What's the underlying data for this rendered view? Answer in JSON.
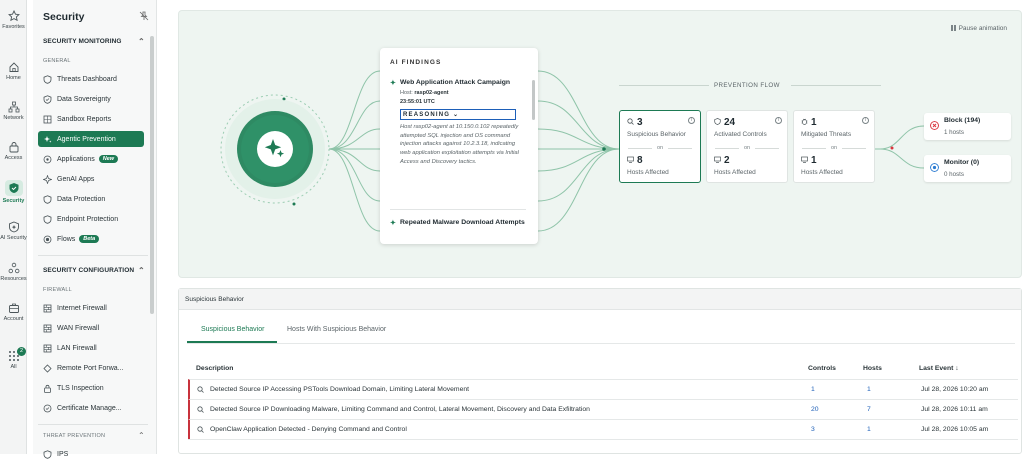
{
  "rail": [
    {
      "label": "Favorites",
      "icon": "star-icon"
    },
    {
      "label": "Home",
      "icon": "home-icon"
    },
    {
      "label": "Network",
      "icon": "network-icon"
    },
    {
      "label": "Access",
      "icon": "lock-icon"
    },
    {
      "label": "Security",
      "icon": "shield-icon"
    },
    {
      "label": "AI Security",
      "icon": "ai-shield-icon"
    },
    {
      "label": "Resources",
      "icon": "resources-icon"
    },
    {
      "label": "Account",
      "icon": "briefcase-icon"
    },
    {
      "label": "All",
      "icon": "apps-grid-icon",
      "badge": "2"
    }
  ],
  "sidebar": {
    "title": "Security",
    "monitoring_header": "SECURITY MONITORING",
    "general_group": "GENERAL",
    "items": [
      {
        "label": "Threats Dashboard"
      },
      {
        "label": "Data Sovereignty"
      },
      {
        "label": "Sandbox Reports"
      },
      {
        "label": "Agentic Prevention"
      },
      {
        "label": "Applications",
        "tag": "New"
      },
      {
        "label": "GenAI Apps"
      },
      {
        "label": "Data Protection"
      },
      {
        "label": "Endpoint Protection"
      },
      {
        "label": "Flows",
        "tag": "Beta"
      }
    ],
    "config_header": "SECURITY CONFIGURATION",
    "firewall_group": "FIREWALL",
    "firewall_items": [
      {
        "label": "Internet Firewall"
      },
      {
        "label": "WAN Firewall"
      },
      {
        "label": "LAN Firewall"
      },
      {
        "label": "Remote Port Forwa..."
      },
      {
        "label": "TLS Inspection"
      },
      {
        "label": "Certificate Manage..."
      }
    ],
    "threat_group": "THREAT PREVENTION",
    "partial_item": "IPS"
  },
  "canvas": {
    "pause_label": "Pause animation",
    "findings": {
      "title": "AI FINDINGS",
      "item1": {
        "name": "Web Application Attack Campaign",
        "host_label": "Host:",
        "host": "rasp02-agent",
        "time": "23:55:01 UTC",
        "reasoning_label": "REASONING",
        "reasoning_text": "Host rasp02-agent at 10.150.0.102 repeatedly attempted SQL injection and OS command injection attacks against 10.2.3.18, indicating web application exploitation attempts via Initial Access and Discovery tactics."
      },
      "item2": {
        "name": "Repeated Malware Download Attempts"
      }
    },
    "flow_label": "PREVENTION FLOW",
    "cards": [
      {
        "count": "3",
        "label": "Suspicious Behavior",
        "on": "on",
        "hosts": "8",
        "hosts_label": "Hosts Affected"
      },
      {
        "count": "24",
        "label": "Activated Controls",
        "on": "on",
        "hosts": "2",
        "hosts_label": "Hosts Affected"
      },
      {
        "count": "1",
        "label": "Mitigated Threats",
        "on": "on",
        "hosts": "1",
        "hosts_label": "Hosts Affected"
      }
    ],
    "outcomes": [
      {
        "title": "Block (194)",
        "sub": "1 hosts",
        "color": "#d9363e"
      },
      {
        "title": "Monitor (0)",
        "sub": "0 hosts",
        "color": "#2b7bd1"
      }
    ]
  },
  "panel": {
    "header": "Suspicious Behavior",
    "tabs": [
      "Suspicious Behavior",
      "Hosts With Suspicious Behavior"
    ],
    "columns": {
      "description": "Description",
      "controls": "Controls",
      "hosts": "Hosts",
      "last_event": "Last Event"
    },
    "rows": [
      {
        "description": "Detected Source IP Accessing PSTools Download Domain, Limiting Lateral Movement",
        "controls": "1",
        "hosts": "1",
        "last_event": "Jul 28, 2026 10:20 am"
      },
      {
        "description": "Detected Source IP Downloading Malware, Limiting Command and Control, Lateral Movement, Discovery and Data Exfiltration",
        "controls": "20",
        "hosts": "7",
        "last_event": "Jul 28, 2026 10:11 am"
      },
      {
        "description": "OpenClaw Application Detected - Denying Command and Control",
        "controls": "3",
        "hosts": "1",
        "last_event": "Jul 28, 2026 10:05 am"
      }
    ]
  },
  "colors": {
    "accent": "#1d7a54",
    "block": "#d9363e",
    "monitor": "#2b7bd1",
    "row_marker": "#c8323c"
  }
}
